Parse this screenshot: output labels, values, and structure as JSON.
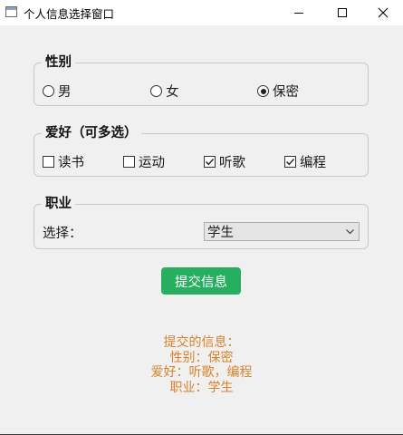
{
  "window": {
    "title": "个人信息选择窗口"
  },
  "gender": {
    "title": "性别",
    "options": [
      {
        "label": "男",
        "checked": false
      },
      {
        "label": "女",
        "checked": false
      },
      {
        "label": "保密",
        "checked": true
      }
    ]
  },
  "hobby": {
    "title": "爱好（可多选）",
    "options": [
      {
        "label": "读书",
        "checked": false
      },
      {
        "label": "运动",
        "checked": false
      },
      {
        "label": "听歌",
        "checked": true
      },
      {
        "label": "编程",
        "checked": true
      }
    ]
  },
  "job": {
    "title": "职业",
    "select_label": "选择：",
    "selected": "学生"
  },
  "submit_label": "提交信息",
  "result": {
    "heading": "提交的信息：",
    "gender_line": "性别：保密",
    "hobby_line": "爱好：听歌，编程",
    "job_line": "职业：学生"
  },
  "colors": {
    "accent": "#27ae60",
    "result_text": "#d9822b"
  }
}
